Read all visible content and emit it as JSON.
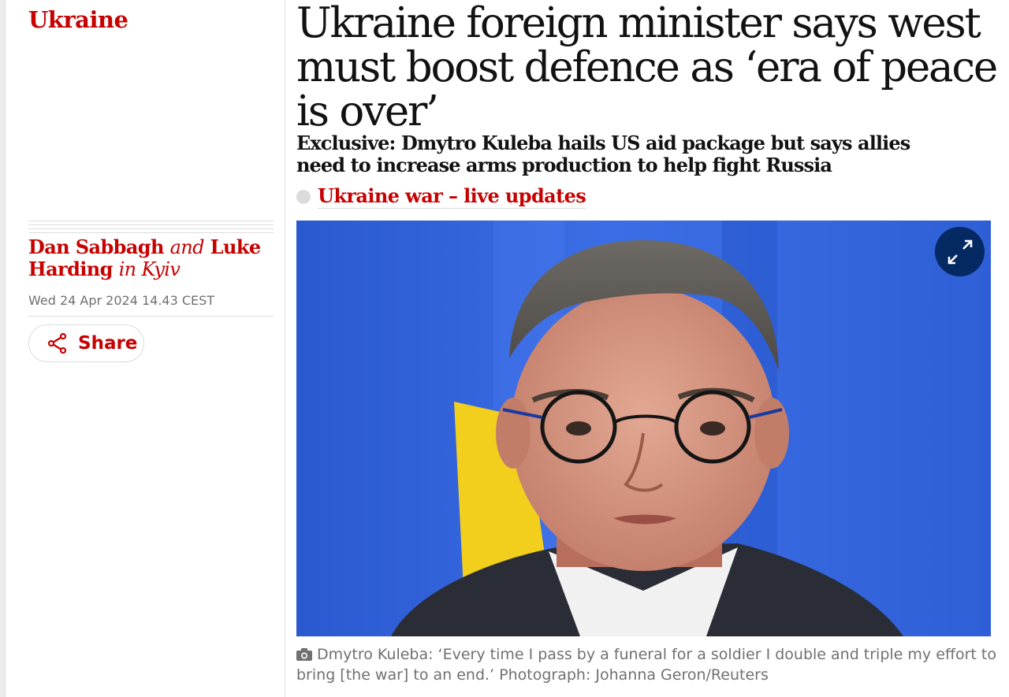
{
  "section": {
    "label": "Ukraine"
  },
  "byline": {
    "author1": "Dan Sabbagh",
    "connector": "and",
    "author2": "Luke Harding",
    "location": "in Kyiv"
  },
  "dateline": "Wed 24 Apr 2024 14.43 CEST",
  "share": {
    "label": "Share"
  },
  "headline": "Ukraine foreign minister says west must boost defence as ‘era of peace is over’",
  "standfirst": "Exclusive: Dmytro Kuleba hails US aid package but says allies need to increase arms production to help fight Russia",
  "live_link": {
    "label": "Ukraine war – live updates"
  },
  "photo": {
    "expand_icon": "expand-arrows-icon"
  },
  "caption": {
    "icon": "camera-icon",
    "text": "Dmytro Kuleba: ‘Every time I pass by a funeral for a soldier I double and triple my effort to bring [the war] to an end.’ Photograph: Johanna Geron/Reuters"
  },
  "colors": {
    "accent_red": "#c70000",
    "navy": "#052962",
    "meta_grey": "#707070",
    "rule_grey": "#dcdcdc"
  }
}
